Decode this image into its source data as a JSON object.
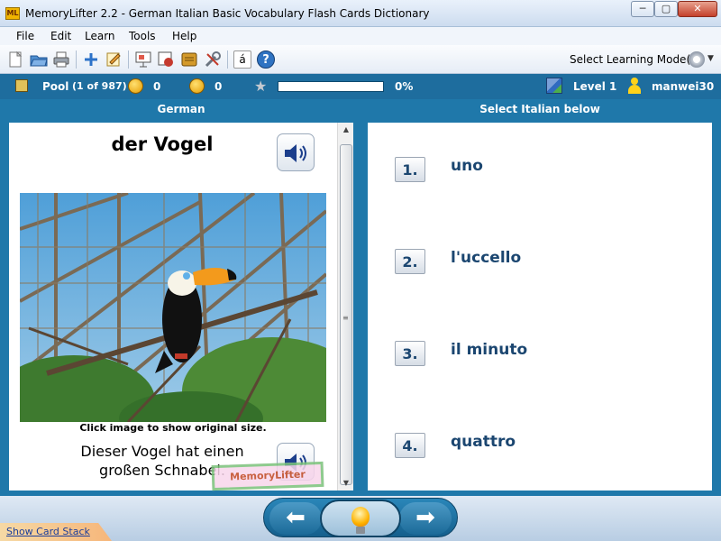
{
  "window": {
    "logo_text": "ML",
    "title": "MemoryLifter 2.2 - German Italian Basic Vocabulary Flash Cards Dictionary",
    "minimize": "─",
    "maximize": "▢",
    "close": "✕"
  },
  "menu": [
    "File",
    "Edit",
    "Learn",
    "Tools",
    "Help"
  ],
  "toolbar": {
    "mode_label": "Select Learning Mode(s)",
    "buttons": [
      "new-icon",
      "open-icon",
      "print-icon",
      "add-icon",
      "edit-icon",
      "presentation-icon",
      "slideshow-icon",
      "card-icon",
      "tools-icon",
      "char-icon",
      "help-icon"
    ],
    "char_button": "á",
    "help_button": "?"
  },
  "status": {
    "pool_label": "Pool",
    "pool_count": "(1 of 987)",
    "known_count": "0",
    "unknown_count": "0",
    "progress_percent": "0%",
    "progress_value": 0,
    "level": "Level 1",
    "user": "manwei30"
  },
  "question": {
    "header": "German",
    "word": "der Vogel",
    "image_caption": "Click image to show original size.",
    "sentence": "Dieser Vogel hat einen großen Schnabel.",
    "watermark": "MemoryLifter"
  },
  "answers": {
    "header": "Select Italian below",
    "options": [
      {
        "number": "1.",
        "text": "uno"
      },
      {
        "number": "2.",
        "text": "l'uccello"
      },
      {
        "number": "3.",
        "text": "il minuto"
      },
      {
        "number": "4.",
        "text": "quattro"
      }
    ]
  },
  "footer": {
    "show_card_stack": "Show Card Stack",
    "prev_arrow": "⬅",
    "next_arrow": "➡"
  },
  "colors": {
    "accent": "#1f78aa",
    "answer_text": "#1b4670",
    "progress_fill": "#58c16a"
  }
}
